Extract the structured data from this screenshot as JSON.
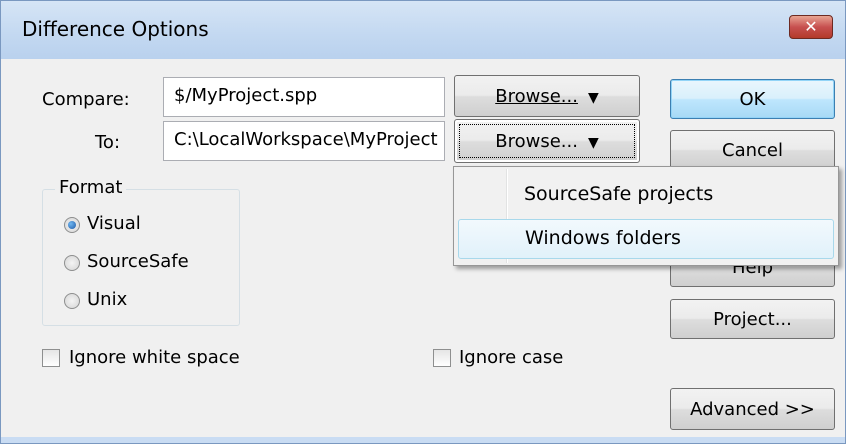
{
  "window": {
    "title": "Difference Options",
    "close_glyph": "✕"
  },
  "compare": {
    "label": "Compare:",
    "value": "$/MyProject.spp",
    "browse_label": "Browse...",
    "arrow": "▼"
  },
  "to": {
    "label": "To:",
    "value": "C:\\LocalWorkspace\\MyProject",
    "browse_label": "Browse...",
    "arrow": "▼"
  },
  "format": {
    "legend": "Format",
    "options": [
      {
        "label": "Visual",
        "selected": true
      },
      {
        "label": "SourceSafe",
        "selected": false
      },
      {
        "label": "Unix",
        "selected": false
      }
    ]
  },
  "checkboxes": {
    "ignore_white_space": {
      "label": "Ignore white space",
      "checked": false
    },
    "ignore_case": {
      "label": "Ignore case",
      "checked": false
    }
  },
  "buttons": {
    "ok": "OK",
    "cancel": "Cancel",
    "help": "Help",
    "project": "Project...",
    "advanced": "Advanced >>"
  },
  "browse_menu": {
    "items": [
      {
        "label": "SourceSafe projects",
        "highlighted": false
      },
      {
        "label": "Windows folders",
        "highlighted": true
      }
    ]
  }
}
